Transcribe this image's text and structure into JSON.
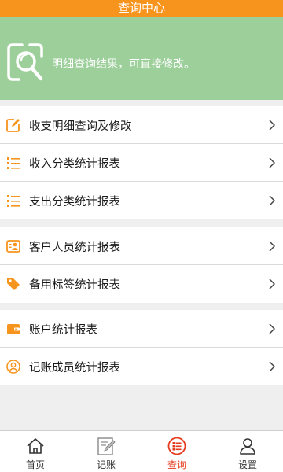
{
  "header": {
    "title": "查询中心"
  },
  "banner": {
    "text": "明细查询结果，可直接修改。"
  },
  "groups": [
    [
      {
        "label": "收支明细查询及修改",
        "icon": "edit-icon"
      },
      {
        "label": "收入分类统计报表",
        "icon": "list-icon"
      },
      {
        "label": "支出分类统计报表",
        "icon": "list-icon"
      }
    ],
    [
      {
        "label": "客户人员统计报表",
        "icon": "contact-card-icon"
      },
      {
        "label": "备用标签统计报表",
        "icon": "tag-icon"
      }
    ],
    [
      {
        "label": "账户统计报表",
        "icon": "wallet-icon"
      },
      {
        "label": "记账成员统计报表",
        "icon": "user-circle-icon"
      }
    ]
  ],
  "tabbar": {
    "items": [
      {
        "label": "首页",
        "icon": "home-icon"
      },
      {
        "label": "记账",
        "icon": "notebook-pen-icon"
      },
      {
        "label": "查询",
        "icon": "query-list-icon",
        "active": true
      },
      {
        "label": "设置",
        "icon": "person-icon"
      }
    ]
  },
  "colors": {
    "accent": "#f7941d",
    "banner": "#9ccf9a",
    "active_tab": "#e63a1d"
  }
}
